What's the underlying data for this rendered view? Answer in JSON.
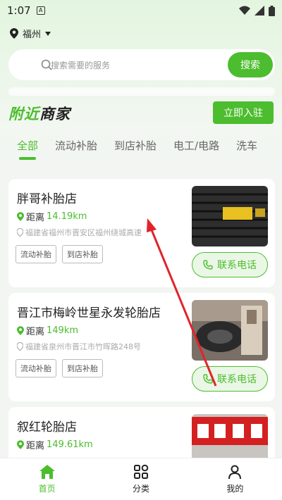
{
  "status_bar": {
    "time": "1:07"
  },
  "location": {
    "city": "福州"
  },
  "search": {
    "placeholder": "搜索需要的服务",
    "button_label": "搜索"
  },
  "section": {
    "title_part1": "附近",
    "title_part2": "商家",
    "join_label": "立即入驻"
  },
  "tabs": [
    {
      "label": "全部",
      "active": true
    },
    {
      "label": "流动补胎",
      "active": false
    },
    {
      "label": "到店补胎",
      "active": false
    },
    {
      "label": "电工/电路",
      "active": false
    },
    {
      "label": "洗车",
      "active": false
    }
  ],
  "shops": [
    {
      "name": "胖哥补胎店",
      "distance_label": "距离",
      "distance_value": "14.19km",
      "address": "福建省福州市晋安区福州绕城高速",
      "tags": [
        "流动补胎",
        "到店补胎"
      ],
      "call_label": "联系电话"
    },
    {
      "name": "晋江市梅岭世星永发轮胎店",
      "distance_label": "距离",
      "distance_value": "149km",
      "address": "福建省泉州市晋江市竹晖路248号",
      "tags": [
        "流动补胎",
        "到店补胎"
      ],
      "call_label": "联系电话"
    },
    {
      "name": "叙红轮胎店",
      "distance_label": "距离",
      "distance_value": "149.61km",
      "address": "",
      "tags": [],
      "call_label": ""
    }
  ],
  "bottom_nav": [
    {
      "label": "首页",
      "icon": "home-icon",
      "active": true
    },
    {
      "label": "分类",
      "icon": "grid-icon",
      "active": false
    },
    {
      "label": "我的",
      "icon": "user-icon",
      "active": false
    }
  ],
  "colors": {
    "accent": "#4cbd2e",
    "annotation_arrow": "#e0242b"
  }
}
